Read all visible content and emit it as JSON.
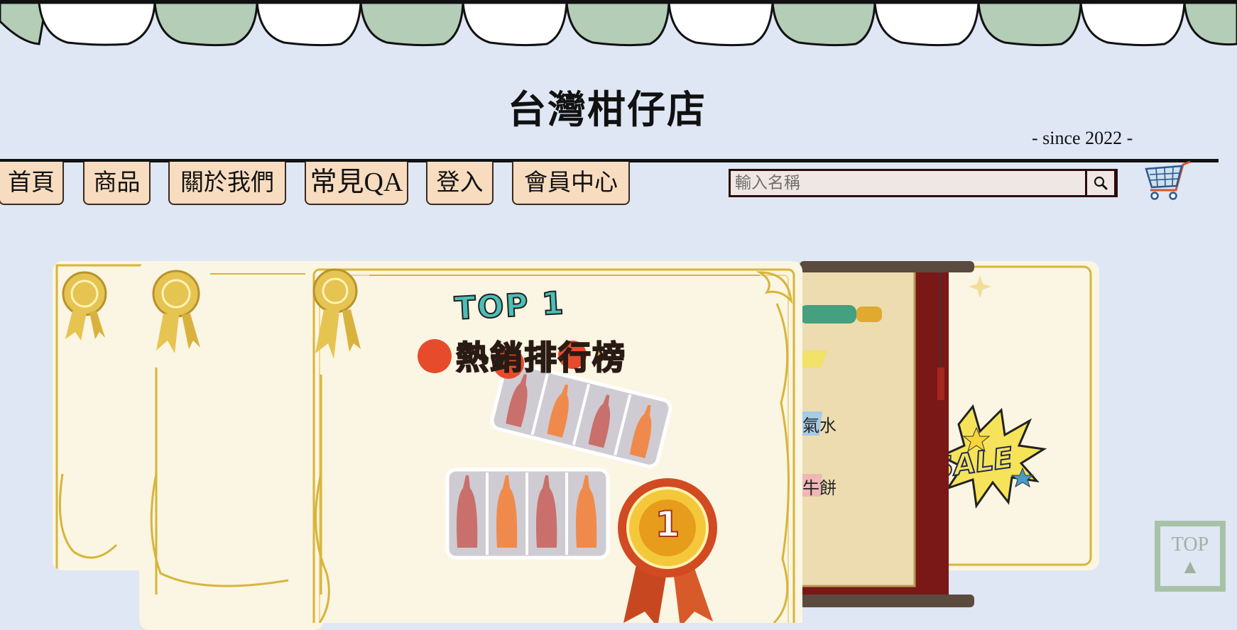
{
  "header": {
    "title": "台灣柑仔店",
    "since": "- since 2022 -"
  },
  "nav": {
    "items": [
      {
        "label": "首頁"
      },
      {
        "label": "商品"
      },
      {
        "label": "關於我們"
      },
      {
        "label": "常見QA"
      },
      {
        "label": "登入"
      },
      {
        "label": "會員中心"
      }
    ]
  },
  "search": {
    "placeholder": "輸入名稱",
    "button_icon": "search-icon"
  },
  "cart": {
    "icon": "shopping-cart-icon"
  },
  "carousel": {
    "main_slide": {
      "badge": "TOP 1",
      "heading": "熱銷排行榜",
      "rank": "1"
    },
    "scroll_slide": {
      "fragments": [
        "氣水",
        "牛餅"
      ]
    },
    "sale_slide": {
      "label": "SALE"
    }
  },
  "back_to_top": {
    "label": "TOP",
    "arrow": "▲"
  },
  "colors": {
    "background": "#dfe6f4",
    "nav_fill": "#f7dcc0",
    "awning_green": "#b3cdb7",
    "card_paper": "#fbf5e3",
    "gold": "#d7b53a"
  }
}
